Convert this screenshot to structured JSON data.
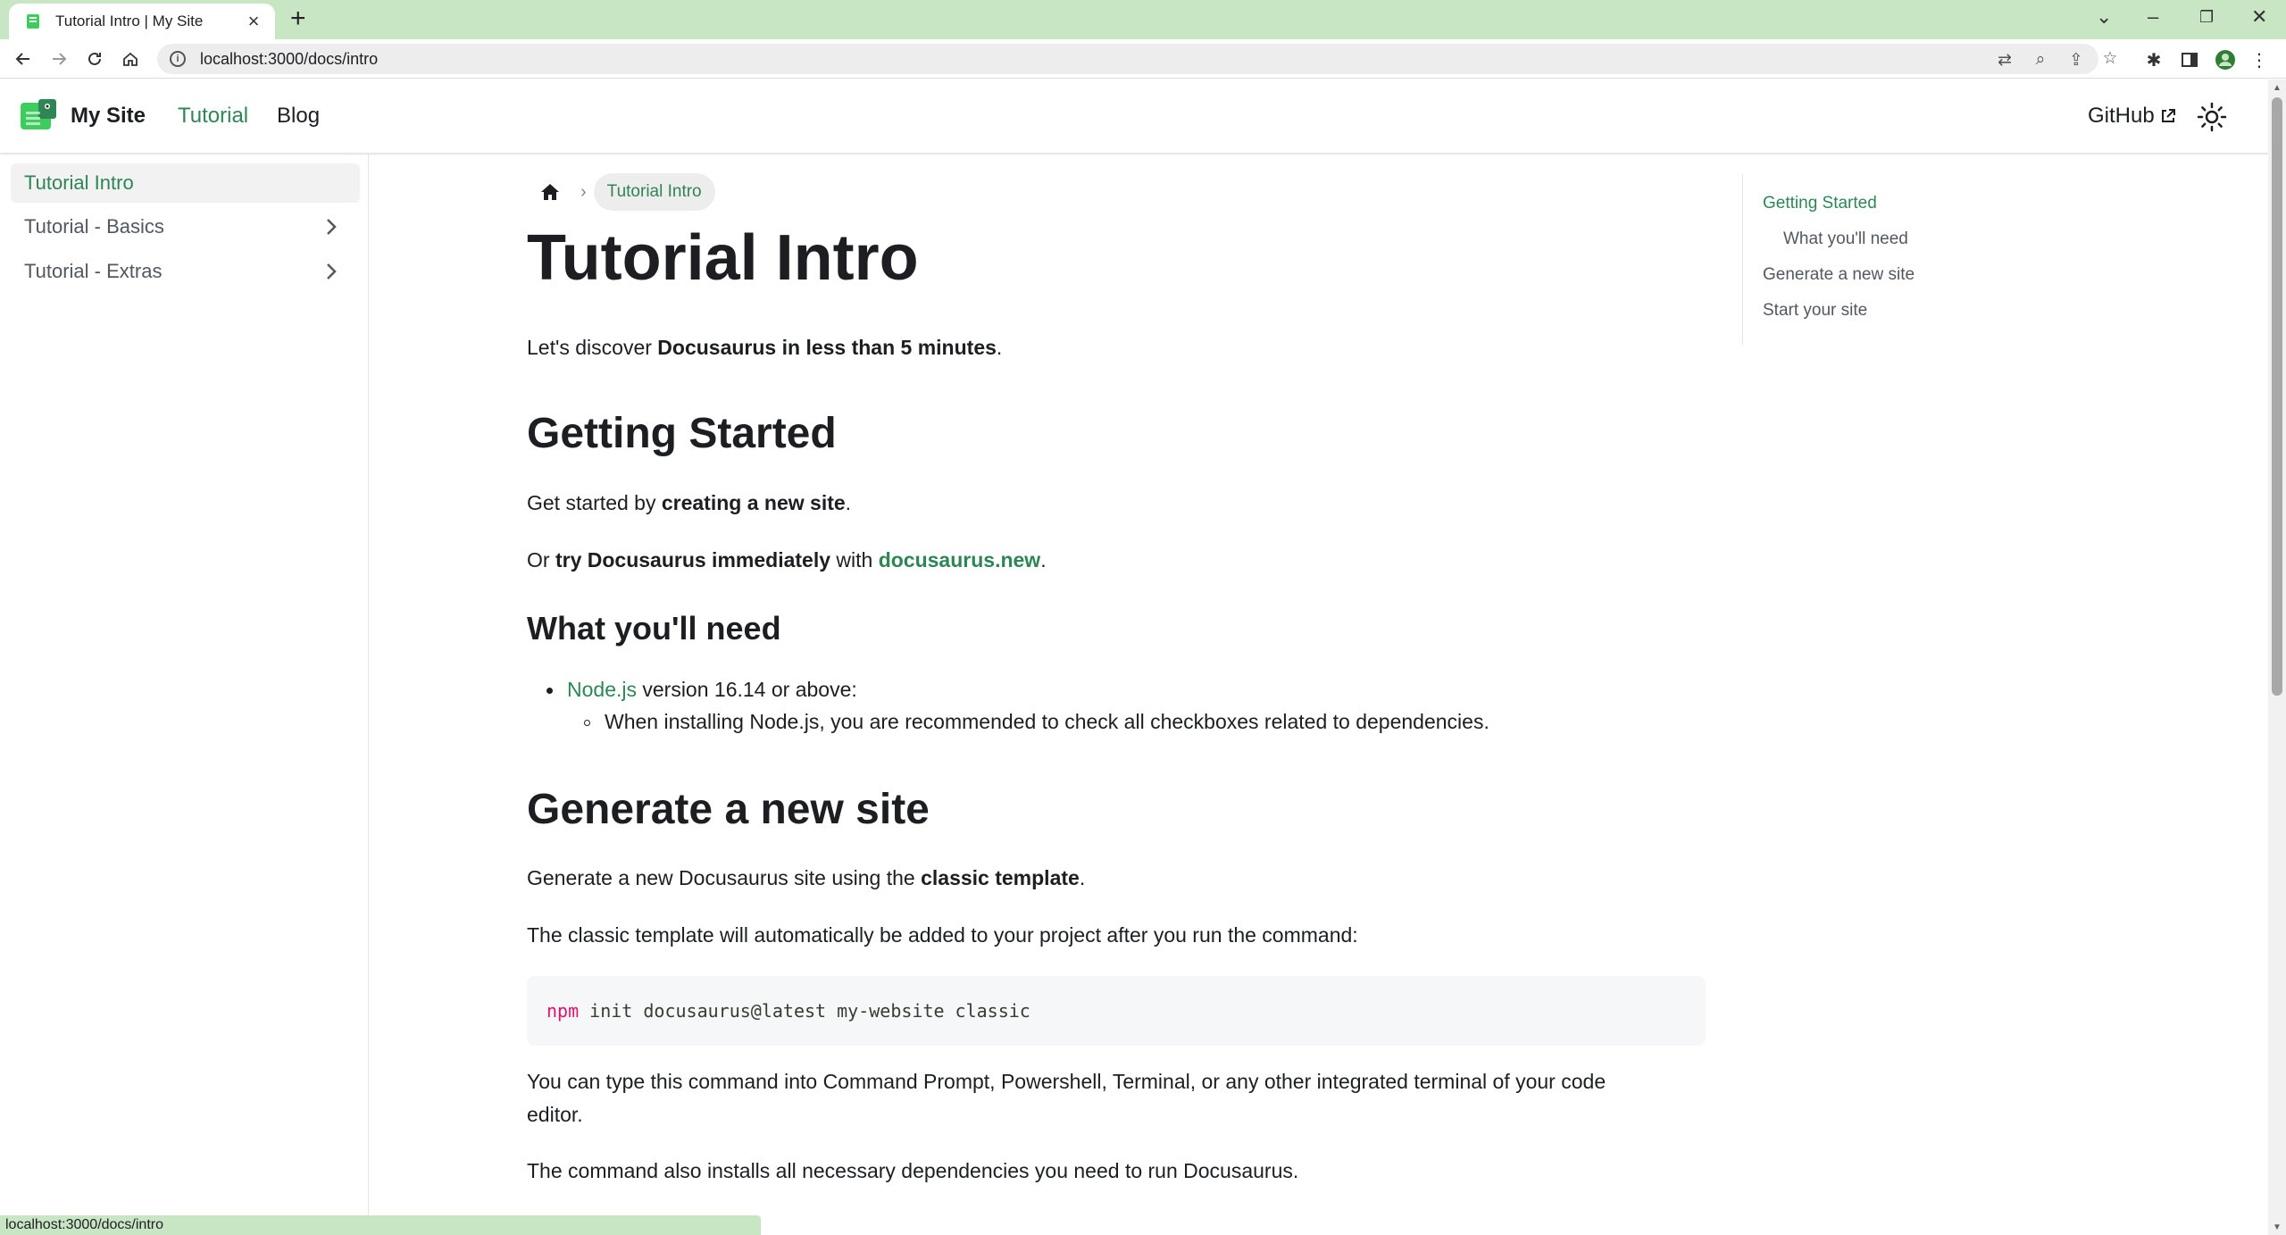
{
  "browser": {
    "tab_title": "Tutorial Intro | My Site",
    "close_glyph": "×",
    "newtab_glyph": "+",
    "url": "localhost:3000/docs/intro",
    "status_url": "localhost:3000/docs/intro"
  },
  "navbar": {
    "brand": "My Site",
    "links": [
      "Tutorial",
      "Blog"
    ],
    "github": "GitHub"
  },
  "sidebar": {
    "items": [
      {
        "label": "Tutorial Intro",
        "active": true
      },
      {
        "label": "Tutorial - Basics"
      },
      {
        "label": "Tutorial - Extras"
      }
    ]
  },
  "breadcrumb": {
    "current": "Tutorial Intro"
  },
  "article": {
    "title": "Tutorial Intro",
    "intro": {
      "pre": "Let's discover ",
      "strong": "Docusaurus in less than 5 minutes",
      "post": "."
    },
    "h_getting_started": "Getting Started",
    "p_started": {
      "pre": "Get started by ",
      "strong": "creating a new site",
      "post": "."
    },
    "p_try": {
      "pre": "Or ",
      "strong": "try Docusaurus immediately",
      "mid": " with ",
      "link": "docusaurus.new",
      "post": "."
    },
    "h_need": "What you'll need",
    "li_node": {
      "link": "Node.js",
      "text": " version 16.14 or above:"
    },
    "li_node_sub": "When installing Node.js, you are recommended to check all checkboxes related to dependencies.",
    "h_generate": "Generate a new site",
    "p_generate": {
      "pre": "Generate a new Docusaurus site using the ",
      "strong": "classic template",
      "post": "."
    },
    "p_classic": "The classic template will automatically be added to your project after you run the command:",
    "code": {
      "cmd": "npm",
      "rest": " init docusaurus@latest my-website classic"
    },
    "p_type_1": "You can type this command into Command Prompt, Powershell, Terminal, or any other integrated terminal of your code",
    "p_type_2": "editor.",
    "p_installs": "The command also installs all necessary dependencies you need to run Docusaurus."
  },
  "toc": {
    "items": [
      "Getting Started",
      "What you'll need",
      "Generate a new site",
      "Start your site"
    ]
  },
  "colors": {
    "primary": "#2e8555",
    "tab_strip": "#c8e6c4"
  }
}
